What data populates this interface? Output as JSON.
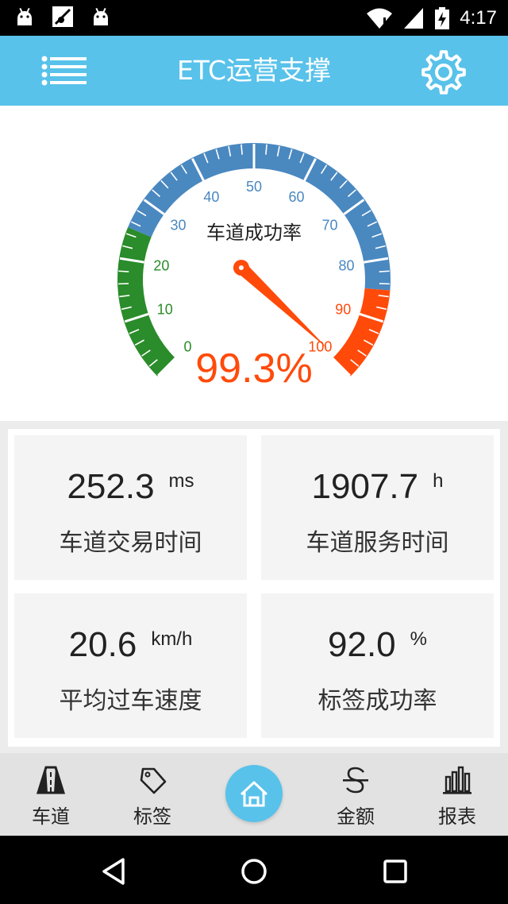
{
  "status_bar": {
    "time": "4:17",
    "icons": [
      "android-icon",
      "notification-icon",
      "android-icon",
      "wifi-icon",
      "signal-icon",
      "battery-charging-icon"
    ]
  },
  "app_bar": {
    "title": "ETC运营支撑",
    "menu_icon": "list-menu-icon",
    "settings_icon": "gear-icon",
    "background_color": "#58c2ea"
  },
  "gauge": {
    "label": "车道成功率",
    "value": 99.3,
    "value_text": "99.3%",
    "min": 0,
    "max": 100,
    "ticks": [
      "0",
      "10",
      "20",
      "30",
      "40",
      "50",
      "60",
      "70",
      "80",
      "90",
      "100"
    ],
    "bands": [
      {
        "from": 0,
        "to": 25,
        "color": "#2a8c2a"
      },
      {
        "from": 25,
        "to": 85,
        "color": "#4a88c0"
      },
      {
        "from": 85,
        "to": 100,
        "color": "#ff4a0a"
      }
    ],
    "needle_color": "#ff4a0a"
  },
  "metrics": [
    {
      "value": "252.3",
      "unit": "ms",
      "label": "车道交易时间"
    },
    {
      "value": "1907.7",
      "unit": "h",
      "label": "车道服务时间"
    },
    {
      "value": "20.6",
      "unit": "km/h",
      "label": "平均过车速度"
    },
    {
      "value": "92.0",
      "unit": "%",
      "label": "标签成功率"
    }
  ],
  "bottom_nav": {
    "items": [
      {
        "label": "车道",
        "icon": "road-icon"
      },
      {
        "label": "标签",
        "icon": "tag-icon"
      },
      {
        "label": "金额",
        "icon": "currency-icon"
      },
      {
        "label": "报表",
        "icon": "bar-chart-icon"
      }
    ],
    "home_icon": "home-icon",
    "accent_color": "#58c2ea"
  },
  "system_nav": {
    "icons": [
      "back-icon",
      "home-circle-icon",
      "recents-icon"
    ]
  }
}
